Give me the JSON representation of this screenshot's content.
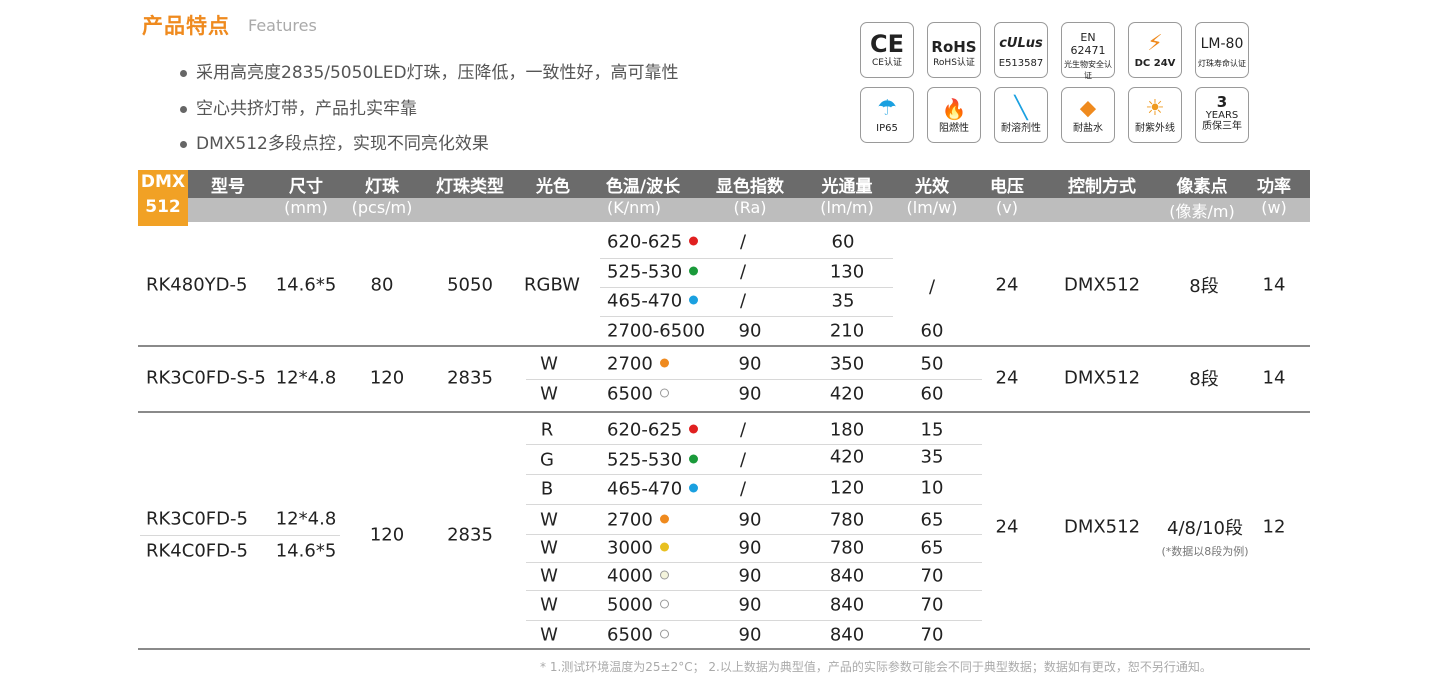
{
  "section": {
    "title": "产品特点",
    "title_en": "Features"
  },
  "features": [
    "采用高亮度2835/5050LED灯珠，压降低，一致性好，高可靠性",
    "空心共挤灯带，产品扎实牢靠",
    "DMX512多段点控，实现不同亮化效果"
  ],
  "badges": [
    {
      "icon": "ce-mark-icon",
      "symbol": "CE",
      "label": "CE认证"
    },
    {
      "icon": "rohs-icon",
      "symbol": "RoHS",
      "label": "RoHS认证"
    },
    {
      "icon": "ul-mark-icon",
      "symbol": "cULus",
      "label": "E513587"
    },
    {
      "icon": "en-standard-icon",
      "symbol": "EN 62471",
      "label": "光生物安全认证"
    },
    {
      "icon": "voltage-warning-icon",
      "symbol": "⚡",
      "label": "DC 24V"
    },
    {
      "icon": "lm80-icon",
      "symbol": "LM-80",
      "label": "灯珠寿命认证"
    },
    {
      "icon": "ip65-umbrella-icon",
      "symbol": "☂",
      "label": "IP65"
    },
    {
      "icon": "flame-icon",
      "symbol": "🔥",
      "label": "阻燃性"
    },
    {
      "icon": "solvent-icon",
      "symbol": "╲",
      "label": "耐溶剂性"
    },
    {
      "icon": "salt-water-icon",
      "symbol": "⬥",
      "label": "耐盐水"
    },
    {
      "icon": "uv-sun-icon",
      "symbol": "☀",
      "label": "耐紫外线"
    },
    {
      "icon": "warranty-icon",
      "symbol": "3",
      "symbol2": "YEARS",
      "label": "质保三年"
    }
  ],
  "table": {
    "dmx_tab": [
      "DMX",
      "512"
    ],
    "headers": [
      "型号",
      "尺寸",
      "灯珠",
      "灯珠类型",
      "光色",
      "色温/波长",
      "显色指数",
      "光通量",
      "光效",
      "电压",
      "控制方式",
      "像素点",
      "功率"
    ],
    "subheaders": [
      "",
      "(mm)",
      "(pcs/m)",
      "",
      "",
      "(K/nm)",
      "(Ra)",
      "(lm/m)",
      "(lm/w)",
      "(v)",
      "",
      "(像素/m)",
      "(w)"
    ],
    "group1": {
      "model": "RK480YD-5",
      "size": "14.6*5",
      "beads": "80",
      "type": "5050",
      "color": "RGBW",
      "voltage": "24",
      "control": "DMX512",
      "pixel": "8段",
      "power": "14",
      "efficacy_merged": "/",
      "rows": [
        {
          "cct": "620-625",
          "dot": "#e02020",
          "ra": "/",
          "lm": "60"
        },
        {
          "cct": "525-530",
          "dot": "#1a9a3a",
          "ra": "/",
          "lm": "130"
        },
        {
          "cct": "465-470",
          "dot": "#1aa0e0",
          "ra": "/",
          "lm": "35"
        },
        {
          "cct": "2700-6500",
          "dot": "",
          "ra": "90",
          "lm": "210",
          "eff": "60"
        }
      ]
    },
    "group2": {
      "model": "RK3C0FD-S-5",
      "size": "12*4.8",
      "beads": "120",
      "type": "2835",
      "voltage": "24",
      "control": "DMX512",
      "pixel": "8段",
      "power": "14",
      "rows": [
        {
          "color": "W",
          "cct": "2700",
          "dot": "#ef8a1e",
          "ra": "90",
          "lm": "350",
          "eff": "50"
        },
        {
          "color": "W",
          "cct": "6500",
          "dot": "#ffffff",
          "ra": "90",
          "lm": "420",
          "eff": "60"
        }
      ]
    },
    "group3": {
      "models": [
        "RK3C0FD-5",
        "RK4C0FD-5"
      ],
      "sizes": [
        "12*4.8",
        "14.6*5"
      ],
      "beads": "120",
      "type": "2835",
      "voltage": "24",
      "control": "DMX512",
      "pixel": "4/8/10段",
      "pixel_note": "(*数据以8段为例)",
      "power": "12",
      "rows": [
        {
          "color": "R",
          "cct": "620-625",
          "dot": "#e02020",
          "ra": "/",
          "lm": "180",
          "eff": "15"
        },
        {
          "color": "G",
          "cct": "525-530",
          "dot": "#1a9a3a",
          "ra": "/",
          "lm": "420",
          "eff": "35"
        },
        {
          "color": "B",
          "cct": "465-470",
          "dot": "#1aa0e0",
          "ra": "/",
          "lm": "120",
          "eff": "10"
        },
        {
          "color": "W",
          "cct": "2700",
          "dot": "#ef8a1e",
          "ra": "90",
          "lm": "780",
          "eff": "65"
        },
        {
          "color": "W",
          "cct": "3000",
          "dot": "#e8c020",
          "ra": "90",
          "lm": "780",
          "eff": "65"
        },
        {
          "color": "W",
          "cct": "4000",
          "dot": "#f4f4dc",
          "ra": "90",
          "lm": "840",
          "eff": "70"
        },
        {
          "color": "W",
          "cct": "5000",
          "dot": "#ffffff",
          "ra": "90",
          "lm": "840",
          "eff": "70"
        },
        {
          "color": "W",
          "cct": "6500",
          "dot": "#ffffff",
          "ra": "90",
          "lm": "840",
          "eff": "70"
        }
      ]
    }
  },
  "footnote": "* 1.测试环境温度为25±2°C；  2.以上数据为典型值，产品的实际参数可能会不同于典型数据；数据如有更改，恕不另行通知。"
}
